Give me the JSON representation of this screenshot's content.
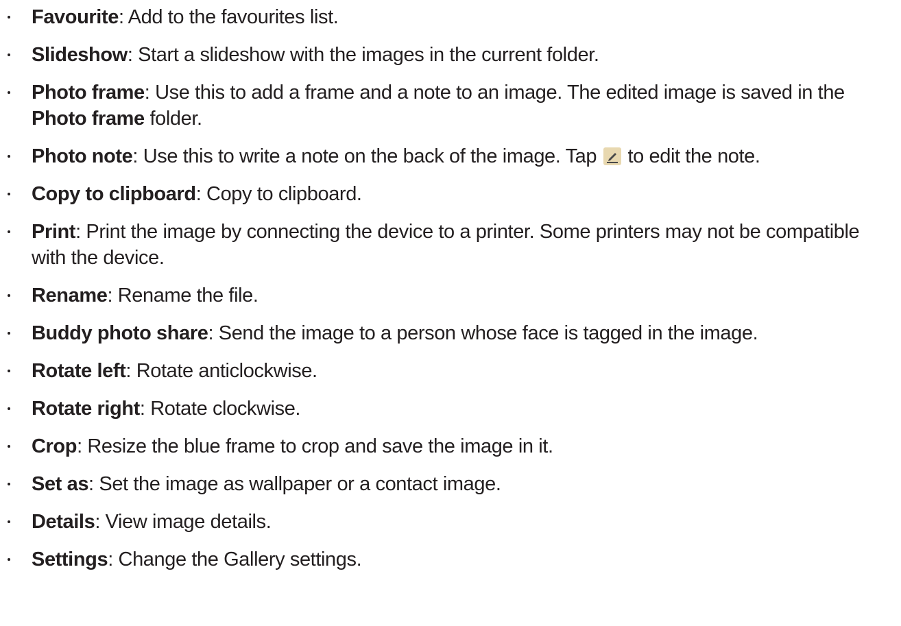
{
  "items": [
    {
      "term": "Favourite",
      "sep": ": ",
      "desc": "Add to the favourites list."
    },
    {
      "term": "Slideshow",
      "sep": ": ",
      "desc": "Start a slideshow with the images in the current folder."
    },
    {
      "term": "Photo frame",
      "sep": ": ",
      "desc": "Use this to add a frame and a note to an image. The edited image is saved in the ",
      "desc_bold": "Photo frame",
      "desc_end": " folder."
    },
    {
      "term": "Photo note",
      "sep": ": ",
      "desc": "Use this to write a note on the back of the image. Tap ",
      "icon": "edit-pencil-icon",
      "desc_end": " to edit the note."
    },
    {
      "term": "Copy to clipboard",
      "sep": ": ",
      "desc": "Copy to clipboard."
    },
    {
      "term": "Print",
      "sep": ": ",
      "desc": "Print the image by connecting the device to a printer. Some printers may not be compatible with the device."
    },
    {
      "term": "Rename",
      "sep": ": ",
      "desc": "Rename the file."
    },
    {
      "term": "Buddy photo share",
      "sep": ": ",
      "desc": "Send the image to a person whose face is tagged in the image."
    },
    {
      "term": "Rotate left",
      "sep": ": ",
      "desc": "Rotate anticlockwise."
    },
    {
      "term": "Rotate right",
      "sep": ": ",
      "desc": "Rotate clockwise."
    },
    {
      "term": "Crop",
      "sep": ": ",
      "desc": "Resize the blue frame to crop and save the image in it."
    },
    {
      "term": "Set as",
      "sep": ": ",
      "desc": "Set the image as wallpaper or a contact image."
    },
    {
      "term": "Details",
      "sep": ": ",
      "desc": "View image details."
    },
    {
      "term": "Settings",
      "sep": ": ",
      "desc": "Change the Gallery settings."
    }
  ],
  "colors": {
    "text": "#231f20",
    "icon_bg": "#e8d8b0",
    "icon_fg": "#4a4a4a"
  }
}
